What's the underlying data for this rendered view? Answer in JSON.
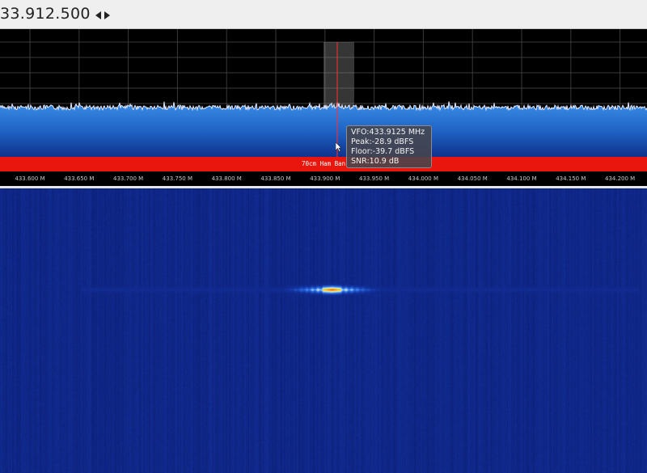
{
  "header": {
    "frequency": "33.912.500",
    "arrows_icon": "left-right-arrows-icon"
  },
  "spectrum": {
    "colors": {
      "background": "#000000",
      "grid": "#3c3c3c",
      "trace": "#e6eaff",
      "fill_top": "#2a7fdc",
      "fill_bottom": "#07124a",
      "vfo_marker": "#ff3030",
      "filter_band": "#9a9a9a"
    }
  },
  "bandplan": {
    "label": "70cm Ham Ban",
    "color": "#e8160c"
  },
  "axis": {
    "ticks": [
      "433.600 M",
      "433.650 M",
      "433.700 M",
      "433.750 M",
      "433.800 M",
      "433.850 M",
      "433.900 M",
      "433.950 M",
      "434.000 M",
      "434.050 M",
      "434.100 M",
      "434.150 M",
      "434.200 M"
    ]
  },
  "tooltip": {
    "vfo": "VFO:433.9125 MHz",
    "peak": "Peak:-28.9 dBFS",
    "floor": "Floor:-39.7 dBFS",
    "snr": "SNR:10.9 dB"
  },
  "waterfall": {
    "colors": {
      "background": "#0a1f7a",
      "signal_hot": "#ff2a00",
      "signal_warm": "#ffe000",
      "signal_mid": "#e8f4ff"
    }
  }
}
